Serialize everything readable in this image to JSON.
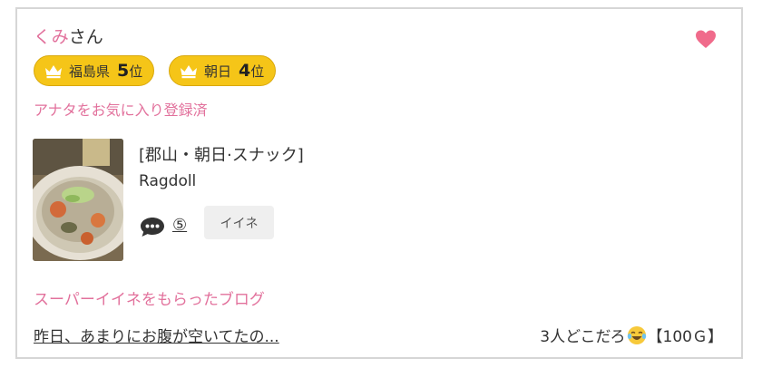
{
  "user": {
    "name": "くみ",
    "suffix": "さん"
  },
  "rankings": [
    {
      "region": "福島県",
      "rank": "5",
      "unit": "位"
    },
    {
      "region": "朝日",
      "rank": "4",
      "unit": "位"
    }
  ],
  "favorite_status": "アナタをお気に入り登録済",
  "post": {
    "category": "[郡山・朝日·スナック]",
    "shop_name": "Ragdoll",
    "comment_count": "⑤",
    "like_label": "イイネ"
  },
  "blog": {
    "heading": "スーパーイイネをもらったブログ",
    "title": "昨日、あまりにお腹が空いてたの...",
    "meta_before": "3人どこだろ",
    "emoji": "laughing-tears-emoji",
    "meta_after": "【100Ｇ】"
  },
  "colors": {
    "accent_pink": "#e2719c",
    "badge_gold": "#f5c518",
    "heart_pink": "#f06b8b"
  },
  "icons": [
    "heart-icon",
    "crown-icon",
    "comment-bubble-icon"
  ]
}
